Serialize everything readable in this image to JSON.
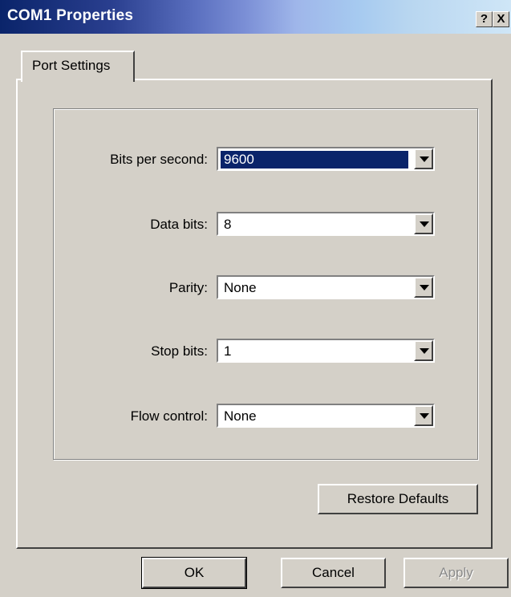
{
  "window": {
    "title": "COM1 Properties",
    "help_label": "?",
    "close_label": "X"
  },
  "tabs": [
    {
      "label": "Port Settings",
      "active": true
    }
  ],
  "fields": {
    "bits_per_second": {
      "label": "Bits per second:",
      "value": "9600"
    },
    "data_bits": {
      "label": "Data bits:",
      "value": "8"
    },
    "parity": {
      "label": "Parity:",
      "value": "None"
    },
    "stop_bits": {
      "label": "Stop bits:",
      "value": "1"
    },
    "flow_control": {
      "label": "Flow control:",
      "value": "None"
    }
  },
  "buttons": {
    "restore_defaults": "Restore Defaults",
    "ok": "OK",
    "cancel": "Cancel",
    "apply": "Apply"
  },
  "colors": {
    "title_bar_start": "#0a246a",
    "face": "#d4d0c8",
    "selection": "#0a246a"
  }
}
